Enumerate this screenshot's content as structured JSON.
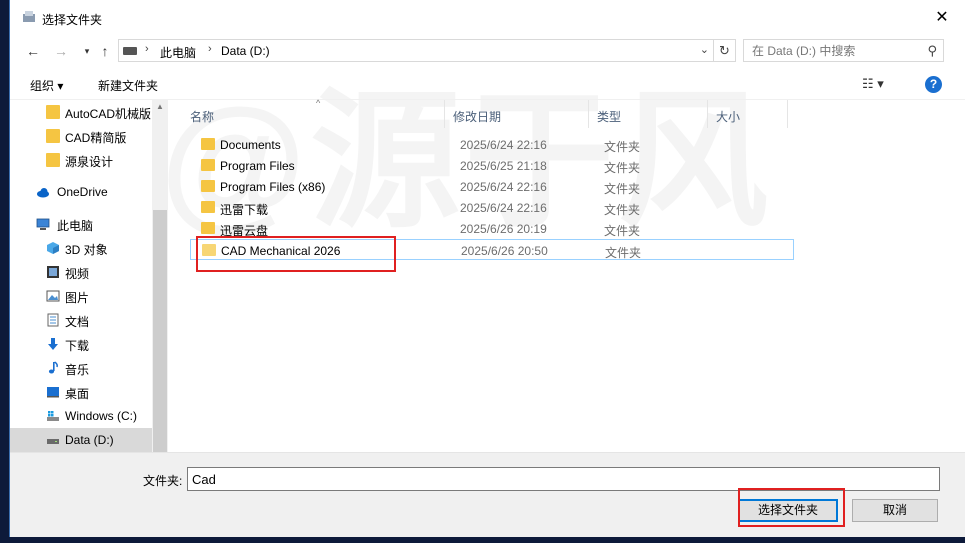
{
  "window": {
    "title": "选择文件夹",
    "close_glyph": "✕"
  },
  "address": {
    "crumbs": [
      "此电脑",
      "Data (D:)"
    ],
    "search_placeholder": "在 Data (D:) 中搜索"
  },
  "toolbar": {
    "organize_label": "组织 ▾",
    "new_folder_label": "新建文件夹",
    "help_label": "?"
  },
  "nav": {
    "items": [
      {
        "label": "AutoCAD机械版",
        "icon": "folder-icon"
      },
      {
        "label": "CAD精简版",
        "icon": "folder-icon"
      },
      {
        "label": "源泉设计",
        "icon": "folder-icon"
      },
      {
        "label": "OneDrive",
        "icon": "cloud-icon"
      },
      {
        "label": "此电脑",
        "icon": "computer-icon"
      },
      {
        "label": "3D 对象",
        "icon": "cube-icon"
      },
      {
        "label": "视频",
        "icon": "video-icon"
      },
      {
        "label": "图片",
        "icon": "picture-icon"
      },
      {
        "label": "文档",
        "icon": "document-icon"
      },
      {
        "label": "下载",
        "icon": "download-icon"
      },
      {
        "label": "音乐",
        "icon": "music-icon"
      },
      {
        "label": "桌面",
        "icon": "desktop-icon"
      },
      {
        "label": "Windows (C:)",
        "icon": "windows-drive-icon"
      },
      {
        "label": "Data (D:)",
        "icon": "drive-icon"
      }
    ]
  },
  "columns": {
    "name": "名称",
    "modified": "修改日期",
    "type": "类型",
    "size": "大小"
  },
  "files": [
    {
      "name": "Documents",
      "modified": "2025/6/24 22:16",
      "type": "文件夹"
    },
    {
      "name": "Program Files",
      "modified": "2025/6/25 21:18",
      "type": "文件夹"
    },
    {
      "name": "Program Files (x86)",
      "modified": "2025/6/24 22:16",
      "type": "文件夹"
    },
    {
      "name": "迅雷下载",
      "modified": "2025/6/24 22:16",
      "type": "文件夹"
    },
    {
      "name": "迅雷云盘",
      "modified": "2025/6/26 20:19",
      "type": "文件夹"
    },
    {
      "name": "CAD Mechanical 2026",
      "modified": "2025/6/26 20:50",
      "type": "文件夹"
    }
  ],
  "footer": {
    "folder_label": "文件夹:",
    "folder_value": "Cad",
    "select_button": "选择文件夹",
    "cancel_button": "取消"
  },
  "colors": {
    "accent": "#0078d7",
    "highlight": "#e02020",
    "folder": "#f5c542"
  }
}
